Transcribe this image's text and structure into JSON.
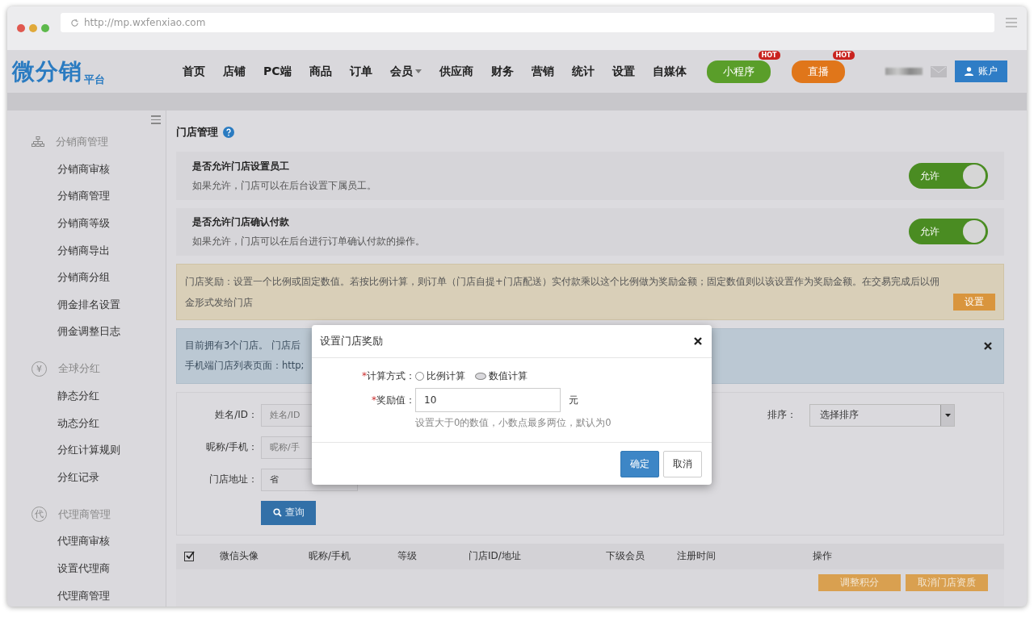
{
  "browser": {
    "url": "http://mp.wxfenxiao.com"
  },
  "logo": {
    "main": "微分销",
    "sub": "平台"
  },
  "nav": [
    {
      "label": "首页",
      "dropdown": false
    },
    {
      "label": "店铺",
      "dropdown": false
    },
    {
      "label": "PC端",
      "dropdown": false
    },
    {
      "label": "商品",
      "dropdown": false
    },
    {
      "label": "订单",
      "dropdown": false
    },
    {
      "label": "会员",
      "dropdown": true
    },
    {
      "label": "供应商",
      "dropdown": false
    },
    {
      "label": "财务",
      "dropdown": false
    },
    {
      "label": "营销",
      "dropdown": false
    },
    {
      "label": "统计",
      "dropdown": false
    },
    {
      "label": "设置",
      "dropdown": false
    },
    {
      "label": "自媒体",
      "dropdown": false
    }
  ],
  "promo_buttons": [
    {
      "label": "小程序",
      "badge": "HOT",
      "color": "#5a9e2a"
    },
    {
      "label": "直播",
      "badge": "HOT",
      "color": "#e0761a"
    }
  ],
  "account_button": "账户",
  "sidebar": [
    {
      "title": "分销商管理",
      "kind": "org",
      "children": [
        {
          "label": "分销商审核"
        },
        {
          "label": "分销商管理"
        },
        {
          "label": "分销商等级"
        },
        {
          "label": "分销商导出"
        },
        {
          "label": "分销商分组"
        },
        {
          "label": "佣金排名设置"
        },
        {
          "label": "佣金调整日志"
        }
      ]
    },
    {
      "title": "全球分红",
      "kind": "char",
      "icon": "¥",
      "children": [
        {
          "label": "静态分红"
        },
        {
          "label": "动态分红"
        },
        {
          "label": "分红计算规则"
        },
        {
          "label": "分红记录"
        }
      ]
    },
    {
      "title": "代理商管理",
      "kind": "char",
      "icon": "代",
      "children": [
        {
          "label": "代理商审核"
        },
        {
          "label": "设置代理商"
        },
        {
          "label": "代理商管理"
        }
      ]
    }
  ],
  "page_title": "门店管理",
  "settings": [
    {
      "title": "是否允许门店设置员工",
      "description": "如果允许，门店可以在后台设置下属员工。",
      "toggle_label": "允许",
      "on": true
    },
    {
      "title": "是否允许门店确认付款",
      "description": "如果允许，门店可以在后台进行订单确认付款的操作。",
      "toggle_label": "允许",
      "on": true
    }
  ],
  "notice": {
    "text": "门店奖励：设置一个比例或固定数值。若按比例计算，则订单（门店自提+门店配送）实付款乘以这个比例做为奖励金额；固定数值则以该设置作为奖励金额。在交易完成后以佣金形式发给门店",
    "button": "设置"
  },
  "info": {
    "lines": [
      "目前拥有3个门店。 门店后",
      "手机端门店列表页面：http;"
    ]
  },
  "filters": {
    "fields": [
      {
        "label": "姓名/ID：",
        "placeholder": "姓名/ID"
      },
      {
        "label": "昵称/手机：",
        "placeholder": "昵称/手"
      },
      {
        "label": "门店地址：",
        "value": "省"
      }
    ],
    "sort_label": "排序：",
    "sort_value": "选择排序",
    "search_button": "查询"
  },
  "table": {
    "select_all_checked": true,
    "columns": [
      "微信头像",
      "昵称/手机",
      "等级",
      "门店ID/地址",
      "下级会员",
      "注册时间",
      "操作"
    ],
    "actions": [
      "调整积分",
      "取消门店资质"
    ]
  },
  "dialog": {
    "title": "设置门店奖励",
    "method_label": "*计算方式：",
    "methods": [
      {
        "label": "比例计算",
        "selected": false
      },
      {
        "label": "数值计算",
        "selected": true
      }
    ],
    "value_label": "*奖励值：",
    "value": "10",
    "unit": "元",
    "hint": "设置大于0的数值，小数点最多两位，默认为0",
    "confirm": "确定",
    "cancel": "取消"
  }
}
